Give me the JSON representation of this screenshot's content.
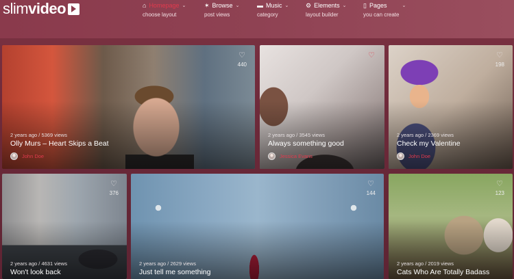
{
  "logo": {
    "light": "slim",
    "bold": "video"
  },
  "nav": [
    {
      "label": "Homepage",
      "sub": "choose layout",
      "icon": "home-icon",
      "active": true
    },
    {
      "label": "Browse",
      "sub": "post views",
      "icon": "star-icon"
    },
    {
      "label": "Music",
      "sub": "category",
      "icon": "folder-icon"
    },
    {
      "label": "Elements",
      "sub": "layout builder",
      "icon": "gears-icon"
    },
    {
      "label": "Pages",
      "sub": "you can create",
      "icon": "page-icon"
    }
  ],
  "cards": [
    {
      "count": "440",
      "meta": "2 years ago / 5369 views",
      "title": "Olly Murs – Heart Skips a Beat",
      "author": "John Doe"
    },
    {
      "count": "",
      "meta": "2 years ago / 3545 views",
      "title": "Always something good",
      "author": "Jessica Evans"
    },
    {
      "count": "198",
      "meta": "2 years ago / 2369 views",
      "title": "Check my Valentine",
      "author": "John Doe"
    },
    {
      "count": "376",
      "meta": "2 years ago / 4631 views",
      "title": "Won't look back",
      "author": ""
    },
    {
      "count": "144",
      "meta": "2 years ago / 2629 views",
      "title": "Just tell me something",
      "author": ""
    },
    {
      "count": "123",
      "meta": "2 years ago / 2019 views",
      "title": "Cats Who Are Totally Badass",
      "author": ""
    }
  ],
  "colors": {
    "accent": "#e23a4d",
    "background": "#6e2a3a"
  }
}
